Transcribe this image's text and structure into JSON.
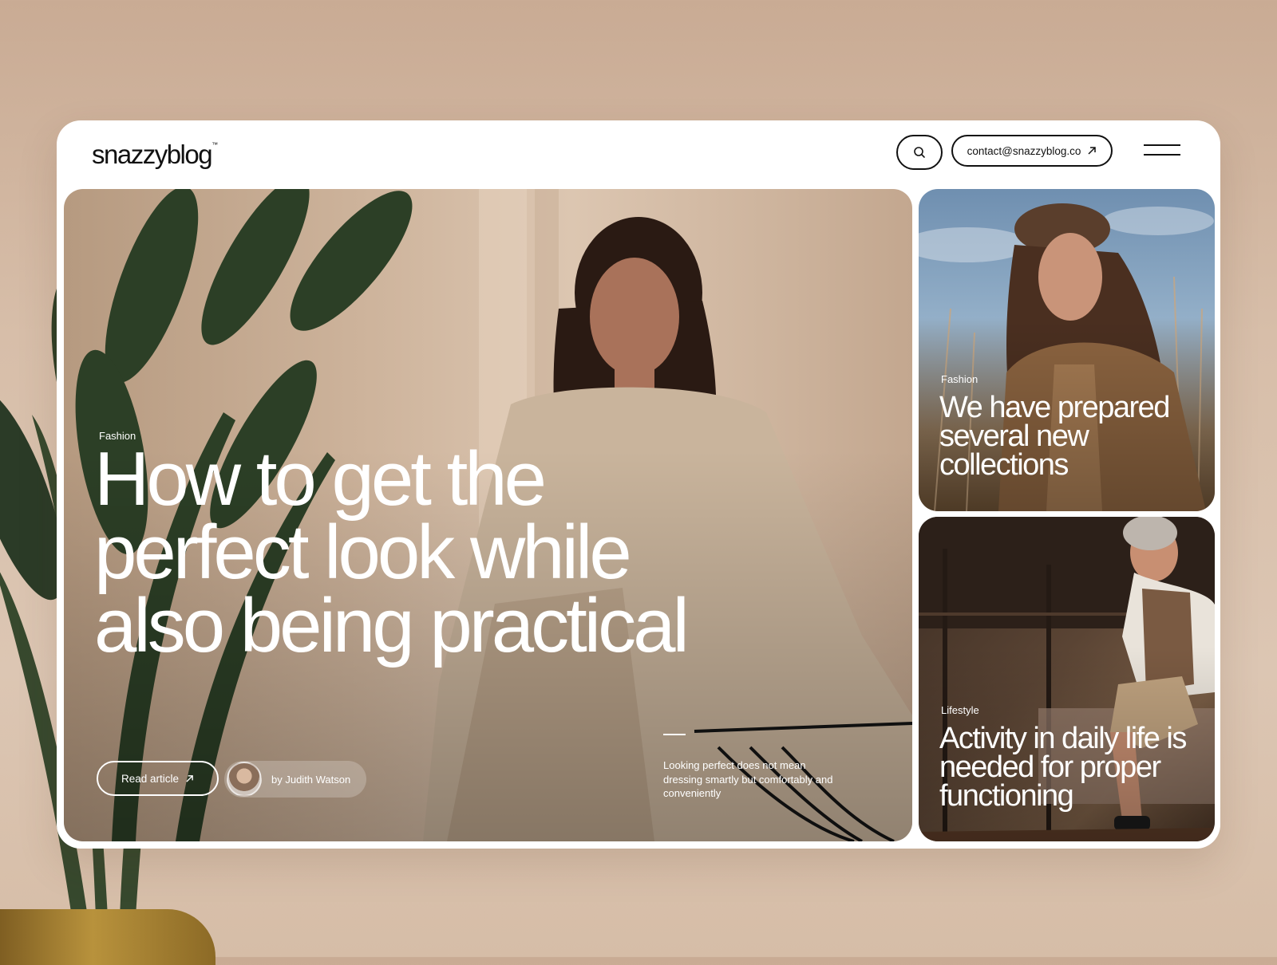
{
  "brand": {
    "name": "snazzyblog",
    "trademark": "™"
  },
  "header": {
    "contact_email": "contact@snazzyblog.co",
    "search_icon": "search-icon",
    "menu_icon": "hamburger-menu-icon"
  },
  "hero": {
    "category": "Fashion",
    "title": "How to get the perfect look while also being practical",
    "read_label": "Read article",
    "author": "by  Judith Watson",
    "description": "Looking perfect does not mean dressing smartly but comfortably and conveniently"
  },
  "cards": [
    {
      "category": "Fashion",
      "title": "We have prepared several new collections"
    },
    {
      "category": "Lifestyle",
      "title": "Activity in daily life is needed for proper functioning"
    }
  ],
  "colors": {
    "background": "#d7bea9",
    "panel": "#ffffff",
    "text_dark": "#111111",
    "text_light": "#ffffff"
  }
}
